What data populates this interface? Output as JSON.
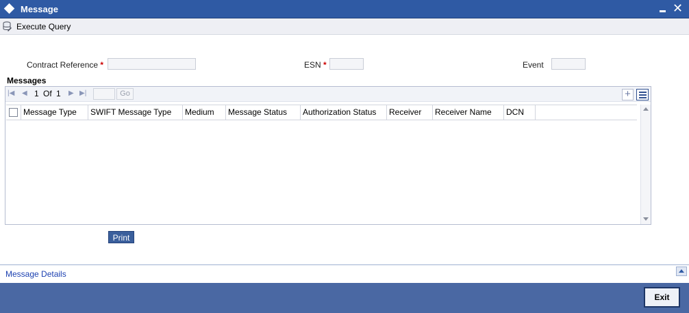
{
  "window": {
    "title": "Message"
  },
  "toolbar": {
    "execute_query_label": "Execute Query"
  },
  "form": {
    "contract_reference_label": "Contract Reference",
    "esn_label": "ESN",
    "event_label": "Event",
    "required_marker": "*",
    "contract_reference_value": "",
    "esn_value": "",
    "event_value": ""
  },
  "messages": {
    "section_title": "Messages",
    "pager": {
      "current": "1",
      "of_label": "Of",
      "total": "1",
      "go_label": "Go",
      "page_input": ""
    },
    "add_label": "+",
    "columns": [
      "Message Type",
      "SWIFT Message Type",
      "Medium",
      "Message Status",
      "Authorization Status",
      "Receiver",
      "Receiver Name",
      "DCN"
    ],
    "rows": []
  },
  "actions": {
    "print_label": "Print",
    "exit_label": "Exit"
  },
  "details": {
    "link_label": "Message Details"
  },
  "colors": {
    "title_bar": "#2f5aa4",
    "footer": "#4a68a3",
    "link": "#1a3fb0",
    "required": "#cc0000"
  }
}
